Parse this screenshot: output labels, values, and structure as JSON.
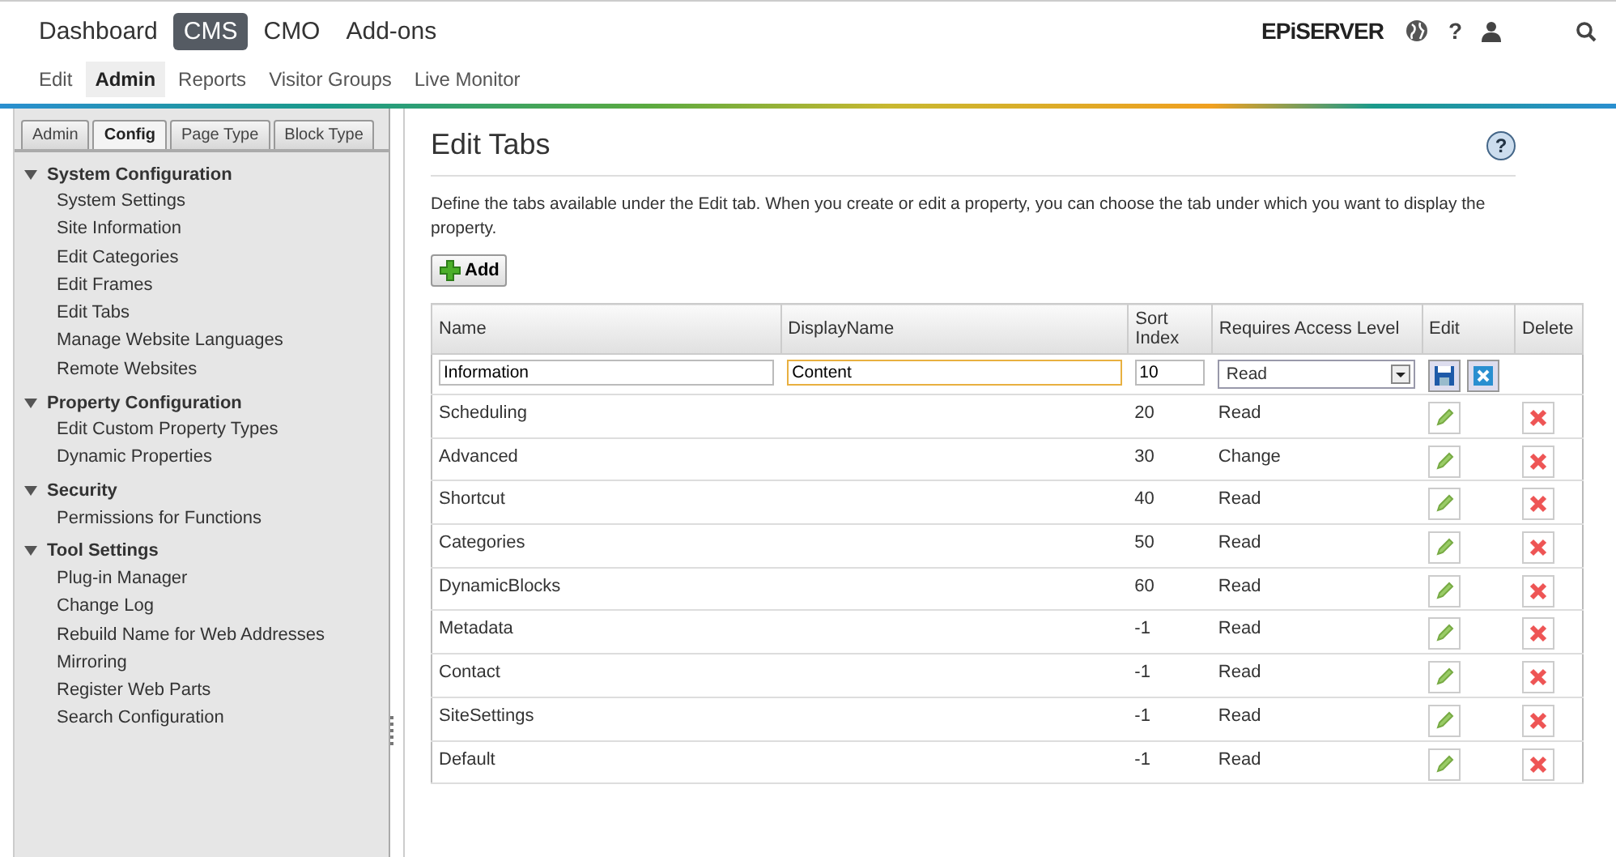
{
  "top_nav": [
    {
      "label": "Dashboard",
      "selected": false
    },
    {
      "label": "CMS",
      "selected": true
    },
    {
      "label": "CMO",
      "selected": false
    },
    {
      "label": "Add-ons",
      "selected": false
    }
  ],
  "sub_nav": [
    {
      "label": "Edit",
      "selected": false
    },
    {
      "label": "Admin",
      "selected": true
    },
    {
      "label": "Reports",
      "selected": false
    },
    {
      "label": "Visitor Groups",
      "selected": false
    },
    {
      "label": "Live Monitor",
      "selected": false
    }
  ],
  "brand": "EPiSERVER",
  "help_glyph": "?",
  "sidebar": {
    "tabs": [
      {
        "label": "Admin",
        "selected": false
      },
      {
        "label": "Config",
        "selected": true
      },
      {
        "label": "Page Type",
        "selected": false
      },
      {
        "label": "Block Type",
        "selected": false
      }
    ],
    "sections": [
      {
        "title": "System Configuration",
        "expanded": true,
        "items": [
          "System Settings",
          "Site Information",
          "Edit Categories",
          "Edit Frames",
          "Edit Tabs",
          "Manage Website Languages",
          "Remote Websites"
        ]
      },
      {
        "title": "Property Configuration",
        "expanded": true,
        "items": [
          "Edit Custom Property Types",
          "Dynamic Properties"
        ]
      },
      {
        "title": "Security",
        "expanded": true,
        "items": [
          "Permissions for Functions"
        ]
      },
      {
        "title": "Tool Settings",
        "expanded": true,
        "items": [
          "Plug-in Manager",
          "Change Log",
          "Rebuild Name for Web Addresses",
          "Mirroring",
          "Register Web Parts",
          "Search Configuration"
        ]
      }
    ]
  },
  "page": {
    "title": "Edit Tabs",
    "help_glyph": "?",
    "description": "Define the tabs available under the Edit tab. When you create or edit a property, you can choose the tab under which you want to display the property.",
    "add_button": "Add"
  },
  "table": {
    "columns": [
      "Name",
      "DisplayName",
      "Sort Index",
      "Requires Access Level",
      "Edit",
      "Delete"
    ],
    "edit_row": {
      "name": "Information",
      "display_name": "Content",
      "sort_index": "10",
      "access_level": "Read"
    },
    "rows": [
      {
        "name": "Scheduling",
        "sort_index": "20",
        "access_level": "Read"
      },
      {
        "name": "Advanced",
        "sort_index": "30",
        "access_level": "Change"
      },
      {
        "name": "Shortcut",
        "sort_index": "40",
        "access_level": "Read"
      },
      {
        "name": "Categories",
        "sort_index": "50",
        "access_level": "Read"
      },
      {
        "name": "DynamicBlocks",
        "sort_index": "60",
        "access_level": "Read"
      },
      {
        "name": "Metadata",
        "sort_index": "-1",
        "access_level": "Read"
      },
      {
        "name": "Contact",
        "sort_index": "-1",
        "access_level": "Read"
      },
      {
        "name": "SiteSettings",
        "sort_index": "-1",
        "access_level": "Read"
      },
      {
        "name": "Default",
        "sort_index": "-1",
        "access_level": "Read"
      }
    ]
  }
}
